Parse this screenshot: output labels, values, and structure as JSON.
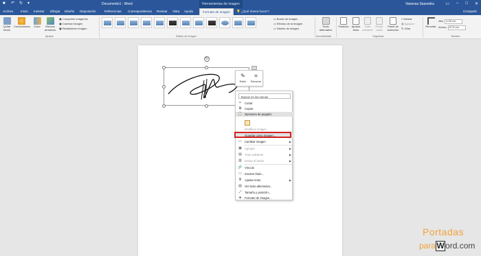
{
  "titlebar": {
    "document_title": "Documento1 - Word",
    "context_tab": "Herramientas de imagen",
    "user": "Vanessa Saavedra"
  },
  "tabs": [
    "Archivo",
    "Inicio",
    "Insertar",
    "Dibujar",
    "Diseño",
    "Disposición",
    "Referencias",
    "Correspondencia",
    "Revisar",
    "Vista",
    "Ayuda",
    "Formato de imagen"
  ],
  "tell_me": "¿Qué desea hacer?",
  "share": "Compartir",
  "ribbon": {
    "adjust": {
      "remove_bg": "Quitar fondo",
      "corrections": "Correcciones",
      "color": "Color",
      "artistic": "Efectos artísticos",
      "compress": "Comprimir imágenes",
      "change": "Cambiar imagen",
      "reset": "Restablecer imagen",
      "group_label": "Ajustar"
    },
    "styles_label": "Estilos de imagen",
    "border": "Borde de imagen",
    "effects": "Efectos de la imagen",
    "layout": "Diseño de imagen",
    "alt_text": "Texto alternativo",
    "accessibility_label": "Accesibilidad",
    "position": "Posición",
    "wrap": "Ajustar texto",
    "forward": "Traer adelante",
    "backward": "Enviar atrás",
    "pane": "Panel de selección",
    "align": "Alinear",
    "group": "Agrupar",
    "rotate": "Girar",
    "arrange_label": "Organizar",
    "crop": "Recortar",
    "height_label": "Alto:",
    "height_value": "4,05 cm",
    "width_label": "Ancho:",
    "width_value": "8,73 cm",
    "size_label": "Tamaño"
  },
  "mini_toolbar": {
    "style": "Estilo",
    "crop": "Recortar"
  },
  "context_menu": {
    "search_placeholder": "Buscar en los menús",
    "items": [
      {
        "label": "Cortar",
        "icon": "scissors-icon",
        "disabled": false
      },
      {
        "label": "Copiar",
        "icon": "copy-icon",
        "disabled": false
      },
      {
        "label": "Opciones de pegado:",
        "icon": "paste-icon",
        "disabled": false
      },
      {
        "label": "Modificar imagen",
        "icon": "",
        "disabled": true
      },
      {
        "label": "Guardar como imagen...",
        "icon": "",
        "disabled": false
      },
      {
        "label": "Cambiar imagen",
        "icon": "picture-icon",
        "disabled": false
      },
      {
        "label": "Agrupar",
        "icon": "group-icon",
        "disabled": true
      },
      {
        "label": "Traer adelante",
        "icon": "bring-forward-icon",
        "disabled": true
      },
      {
        "label": "Enviar al fondo",
        "icon": "send-back-icon",
        "disabled": true
      },
      {
        "label": "Vínculo",
        "icon": "link-icon",
        "disabled": false
      },
      {
        "label": "Insertar título...",
        "icon": "caption-icon",
        "disabled": false
      },
      {
        "label": "Ajustar texto",
        "icon": "wrap-icon",
        "disabled": false
      },
      {
        "label": "Ver texto alternativo...",
        "icon": "alt-text-icon",
        "disabled": false
      },
      {
        "label": "Tamaño y posición...",
        "icon": "size-icon",
        "disabled": false
      },
      {
        "label": "Formato de imagen...",
        "icon": "format-icon",
        "disabled": false
      }
    ]
  },
  "watermark": {
    "line1": "Portadas",
    "line2_prefix": "para",
    "line2_box": "W",
    "line2_suffix": "ord.com"
  },
  "colors": {
    "accent": "#2b579a",
    "highlight": "#d42020",
    "brand": "#f0a23a"
  }
}
